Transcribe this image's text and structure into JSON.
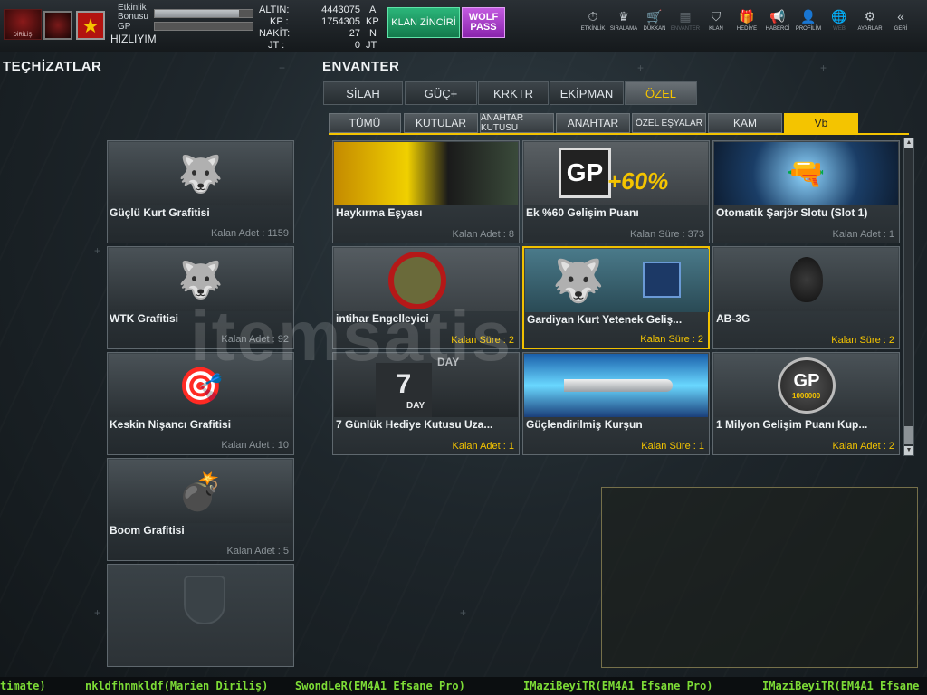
{
  "topbar": {
    "logo_text": "DİRİLİŞ",
    "event_bonus_label": "Etkinlik Bonusu",
    "event_bonus_fill": 0.86,
    "gp_label": "GP",
    "gp_fill": 0.0,
    "rank_label": "HIZLIYIM",
    "currency": [
      {
        "label": "ALTIN:",
        "value": "4443075",
        "unit": "A"
      },
      {
        "label": "KP :",
        "value": "1754305",
        "unit": "KP"
      },
      {
        "label": "NAKİT:",
        "value": "27",
        "unit": "N"
      },
      {
        "label": "JT :",
        "value": "0",
        "unit": "JT"
      }
    ],
    "klan_zinciri": "KLAN ZİNCİRİ",
    "wolf_pass": "WOLF PASS",
    "nav": [
      {
        "label": "ETKİNLİK",
        "icon": "stopwatch-icon",
        "glyph": "⏱",
        "enabled": true
      },
      {
        "label": "SIRALAMA",
        "icon": "ranking-icon",
        "glyph": "♛",
        "enabled": true
      },
      {
        "label": "DÜKKAN",
        "icon": "cart-icon",
        "glyph": "🛒",
        "enabled": true
      },
      {
        "label": "ENVANTER",
        "icon": "inventory-icon",
        "glyph": "▦",
        "enabled": false
      },
      {
        "label": "KLAN",
        "icon": "shield-icon",
        "glyph": "⛉",
        "enabled": true
      },
      {
        "label": "HEDİYE",
        "icon": "gift-icon",
        "glyph": "🎁",
        "enabled": true
      },
      {
        "label": "HABERCİ",
        "icon": "megaphone-icon",
        "glyph": "📢",
        "enabled": true
      },
      {
        "label": "PROFİLİM",
        "icon": "profile-icon",
        "glyph": "👤",
        "enabled": true
      },
      {
        "label": "WEB",
        "icon": "globe-icon",
        "glyph": "🌐",
        "enabled": false
      },
      {
        "label": "AYARLAR",
        "icon": "gear-icon",
        "glyph": "⚙",
        "enabled": true
      },
      {
        "label": "GERİ",
        "icon": "back-icon",
        "glyph": "«",
        "enabled": true
      }
    ]
  },
  "equipment": {
    "title": "TEÇHİZATLAR",
    "items": [
      {
        "name": "Güçlü Kurt Grafitisi",
        "remaining": "Kalan Adet : 1159",
        "icon": "🐺"
      },
      {
        "name": "WTK Grafitisi",
        "remaining": "Kalan Adet : 92",
        "icon": "🐺"
      },
      {
        "name": "Keskin Nişancı Grafitisi",
        "remaining": "Kalan Adet : 10",
        "icon": "🎯"
      },
      {
        "name": "Boom Grafitisi",
        "remaining": "Kalan Adet : 5",
        "icon": "💣"
      },
      {
        "name": "",
        "remaining": "",
        "icon": ""
      }
    ]
  },
  "inventory": {
    "title": "ENVANTER",
    "tabs": [
      "SİLAH",
      "GÜÇ+",
      "KRKTR",
      "EKİPMAN",
      "ÖZEL"
    ],
    "active_tab": 4,
    "subtabs": [
      "TÜMÜ",
      "KUTULAR",
      "ANAHTAR KUTUSU",
      "ANAHTAR",
      "ÖZEL EŞYALAR",
      "KAM",
      "Vb"
    ],
    "active_subtab": 6,
    "items": [
      {
        "name": "Haykırma Eşyası",
        "remaining": "Kalan Adet : 8",
        "highlight": false
      },
      {
        "name": "Ek %60 Gelişim Puanı",
        "remaining": "Kalan Süre : 373",
        "highlight": false
      },
      {
        "name": "Otomatik Şarjör Slotu (Slot 1)",
        "remaining": "Kalan Adet : 1",
        "highlight": false
      },
      {
        "name": "intihar Engelleyici",
        "remaining": "Kalan Süre : 2",
        "highlight": true
      },
      {
        "name": "Gardiyan Kurt Yetenek Geliş...",
        "remaining": "Kalan Süre : 2",
        "highlight": true
      },
      {
        "name": "AB-3G",
        "remaining": "Kalan Süre : 2",
        "highlight": true
      },
      {
        "name": "7 Günlük Hediye Kutusu Uza...",
        "remaining": "Kalan Adet : 1",
        "highlight": true
      },
      {
        "name": "Güçlendirilmiş Kurşun",
        "remaining": "Kalan Süre : 1",
        "highlight": true
      },
      {
        "name": "1 Milyon Gelişim Puanı Kup...",
        "remaining": "Kalan Adet : 2",
        "highlight": true
      }
    ],
    "thumb_texts": {
      "gp": "GP",
      "plus60": "+60%",
      "day7": "7",
      "day": "DAY",
      "gp_million": "1000000"
    }
  },
  "watermark": "itemsatis",
  "ticker": [
    "timate)",
    "nkldfhnmkldf(Marien Diriliş)",
    "SwondLeR(EM4A1 Efsane Pro)",
    "IMaziBeyiTR(EM4A1 Efsane Pro)",
    "IMaziBeyiTR(EM4A1 Efsane"
  ]
}
